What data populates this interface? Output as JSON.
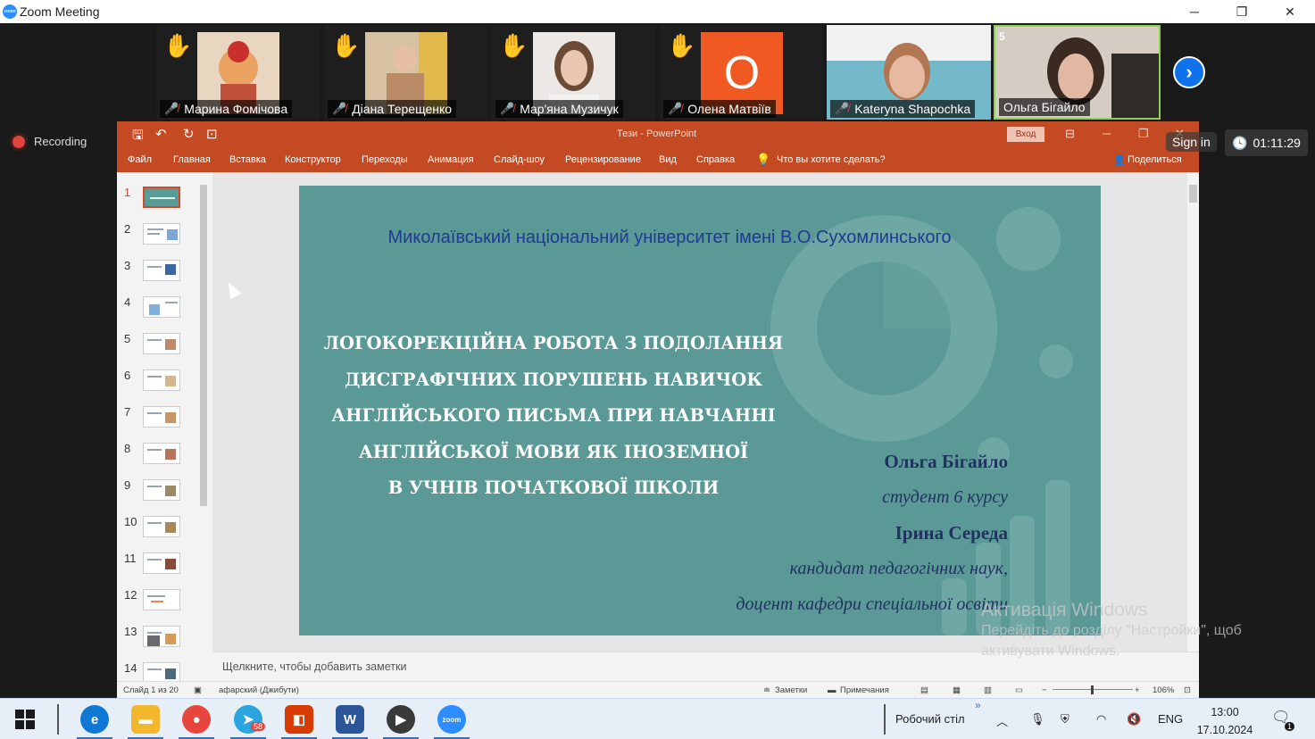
{
  "zoom": {
    "window_title": "Zoom Meeting",
    "window_controls": {
      "minimize": "─",
      "restore": "❐",
      "close": "✕"
    },
    "participants": [
      {
        "name": "Марина Фомічова",
        "portrait_color": "#e9b77a"
      },
      {
        "name": "Діана Терещенко",
        "portrait_color": "#c7a07a"
      },
      {
        "name": "Мар'яна Музичук",
        "portrait_color": "#e8e4e0"
      },
      {
        "name": "Олена Матвіїв",
        "portrait_color": "#f05a22",
        "initial": "O"
      },
      {
        "name": "Kateryna Shapochka",
        "portrait_color": "#7fb9c8"
      },
      {
        "name": "Ольга Бігайло",
        "portrait_color": "#bfb4aa",
        "count": "5"
      }
    ],
    "next_label": "›",
    "recording_label": "Recording",
    "sign_in_label": "Sign in",
    "timer": "01:11:29"
  },
  "ppt": {
    "doc_title": "Тези  -  PowerPoint",
    "sign_in_button": "Вход",
    "quick_access": {
      "save": "🖫",
      "undo": "↶",
      "redo": "↻",
      "present": "⊡"
    },
    "title_controls": {
      "ribbon": "⊟",
      "minimize": "─",
      "restore": "❐",
      "close": "✕"
    },
    "ribbon_tabs": [
      "Файл",
      "Главная",
      "Вставка",
      "Конструктор",
      "Переходы",
      "Анимация",
      "Слайд-шоу",
      "Рецензирование",
      "Вид",
      "Справка"
    ],
    "search_placeholder": "Что вы хотите сделать?",
    "share_label": "Поделиться",
    "thumb_numbers": [
      "1",
      "2",
      "3",
      "4",
      "5",
      "6",
      "7",
      "8",
      "9",
      "10",
      "11",
      "12",
      "13",
      "14"
    ],
    "slide": {
      "university": "Миколаївський національний університет імені В.О.Сухомлинського",
      "heading_lines": [
        "ЛОГОКОРЕКЦІЙНА РОБОТА З ПОДОЛАННЯ",
        "ДИСГРАФІЧНИХ ПОРУШЕНЬ НАВИЧОК",
        "АНГЛІЙСЬКОГО ПИСЬМА ПРИ НАВЧАННІ",
        "АНГЛІЙСЬКОЇ МОВИ ЯК ІНОЗЕМНОЇ",
        "В УЧНІВ ПОЧАТКОВОЇ ШКОЛИ"
      ],
      "author_name": "Ольга Бігайло",
      "author_role": "студент 6 курсу",
      "supervisor_name": "Ірина Середа",
      "supervisor_degree": "кандидат педагогічних наук,",
      "supervisor_position": "доцент кафедри спеціальної освіти",
      "background_color": "#5b9996",
      "accent_blue": "#1f3a8f"
    },
    "notes_placeholder": "Щелкните, чтобы добавить заметки",
    "status": {
      "slide_counter": "Слайд 1 из 20",
      "language": "афарский (Джибути)",
      "notes_btn": "Заметки",
      "comments_btn": "Примечания",
      "zoom_minus": "−",
      "zoom_plus": "+",
      "zoom_level": "106%"
    }
  },
  "activation": {
    "line1": "Активація Windows",
    "line2": "Перейдіть до розділу \"Настройки\", щоб",
    "line3": "активувати Windows."
  },
  "taskbar": {
    "telegram_badge": "58",
    "desktop_label": "Робочий стіл",
    "chevron_right": "»",
    "chevron_up": "︿",
    "language": "ENG",
    "time": "13:00",
    "date": "17.10.2024",
    "notification_count": "1",
    "app_colors": {
      "edge": "#0f78d4",
      "explorer": "#f3b72e",
      "chrome": "#e8453c",
      "telegram": "#2aa5e0",
      "office": "#d83b01",
      "word": "#2b579a",
      "player": "#3a3a3a",
      "zoom": "#2d8cff"
    }
  }
}
